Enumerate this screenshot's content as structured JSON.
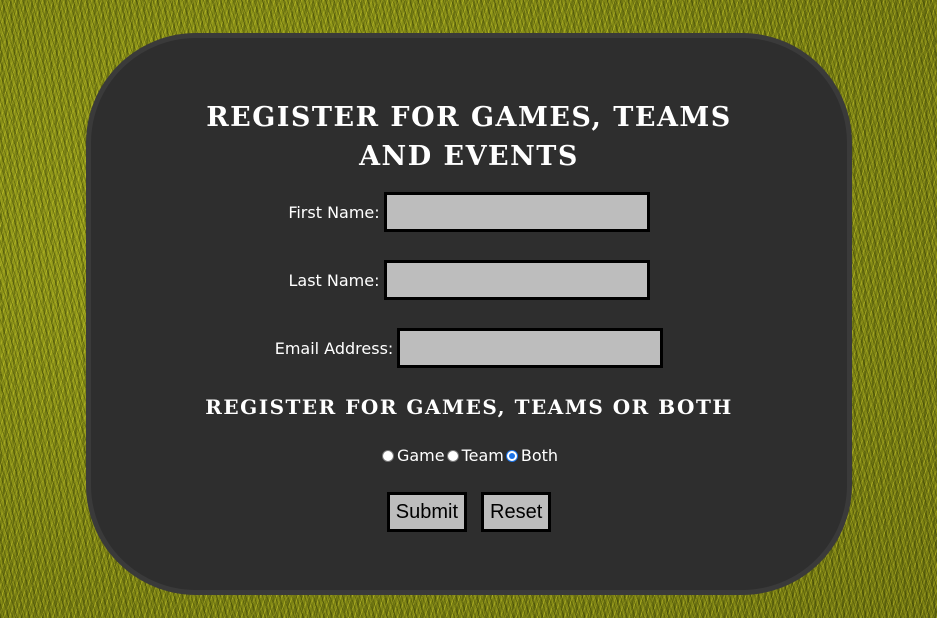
{
  "form": {
    "title": "REGISTER FOR GAMES, TEAMS AND EVENTS",
    "first_name_label": "First Name:",
    "first_name_value": "",
    "last_name_label": "Last Name:",
    "last_name_value": "",
    "email_label": "Email Address:",
    "email_value": "",
    "choice_title": "REGISTER FOR GAMES, TEAMS OR BOTH",
    "options": [
      {
        "label": "Game",
        "checked": false
      },
      {
        "label": "Team",
        "checked": false
      },
      {
        "label": "Both",
        "checked": true
      }
    ],
    "submit_label": "Submit",
    "reset_label": "Reset"
  },
  "colors": {
    "card_background": "#2e2e2e",
    "field_background": "#bdbdbd",
    "radio_accent": "#1a73e8"
  }
}
